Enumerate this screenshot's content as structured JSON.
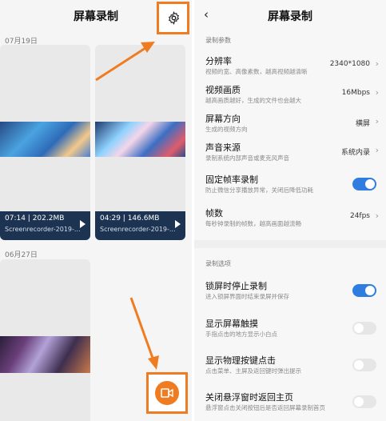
{
  "left": {
    "title": "屏幕录制",
    "groups": [
      {
        "date": "07月19日",
        "videos": [
          {
            "duration_size": "07:14 | 202.2MB",
            "filename": "Screenrecorder-2019-..."
          },
          {
            "duration_size": "04:29 | 146.6MB",
            "filename": "Screenrecorder-2019-..."
          }
        ]
      },
      {
        "date": "06月27日"
      }
    ]
  },
  "right": {
    "title": "屏幕录制",
    "section1": "录制参数",
    "section2": "录制选项",
    "rows": [
      {
        "title": "分辨率",
        "sub": "视频的宽、高像素数，越高视频越清晰",
        "value": "2340*1080"
      },
      {
        "title": "视频画质",
        "sub": "越高画质越好，生成的文件也会越大",
        "value": "16Mbps"
      },
      {
        "title": "屏幕方向",
        "sub": "生成的视频方向",
        "value": "横屏"
      },
      {
        "title": "声音来源",
        "sub": "录制系统内部声音或麦克风声音",
        "value": "系统内录"
      },
      {
        "title": "固定帧率录制",
        "sub": "防止微信分享播放异常，关闭后降低功耗",
        "toggle": true
      },
      {
        "title": "帧数",
        "sub": "每秒钟录制的帧数，越高画面越流畅",
        "value": "24fps"
      },
      {
        "title": "锁屏时停止录制",
        "sub": "进入锁屏界面时结束录屏并保存",
        "toggle": true
      },
      {
        "title": "显示屏幕触摸",
        "sub": "手指点击的地方显示小白点",
        "toggle": false
      },
      {
        "title": "显示物理按键点击",
        "sub": "点击菜单、主屏及返回键时弹出提示",
        "toggle": false
      },
      {
        "title": "关闭悬浮窗时返回主页",
        "sub": "悬浮窗点击关闭按钮后是否返回屏幕录制首页",
        "toggle": false
      }
    ]
  },
  "colors": {
    "accent": "#f07c22",
    "toggle_on": "#2f7de0",
    "card_footer": "#1c3352"
  },
  "icons": [
    "settings-gear-icon",
    "record-camera-icon",
    "back-chevron-icon",
    "play-icon"
  ]
}
